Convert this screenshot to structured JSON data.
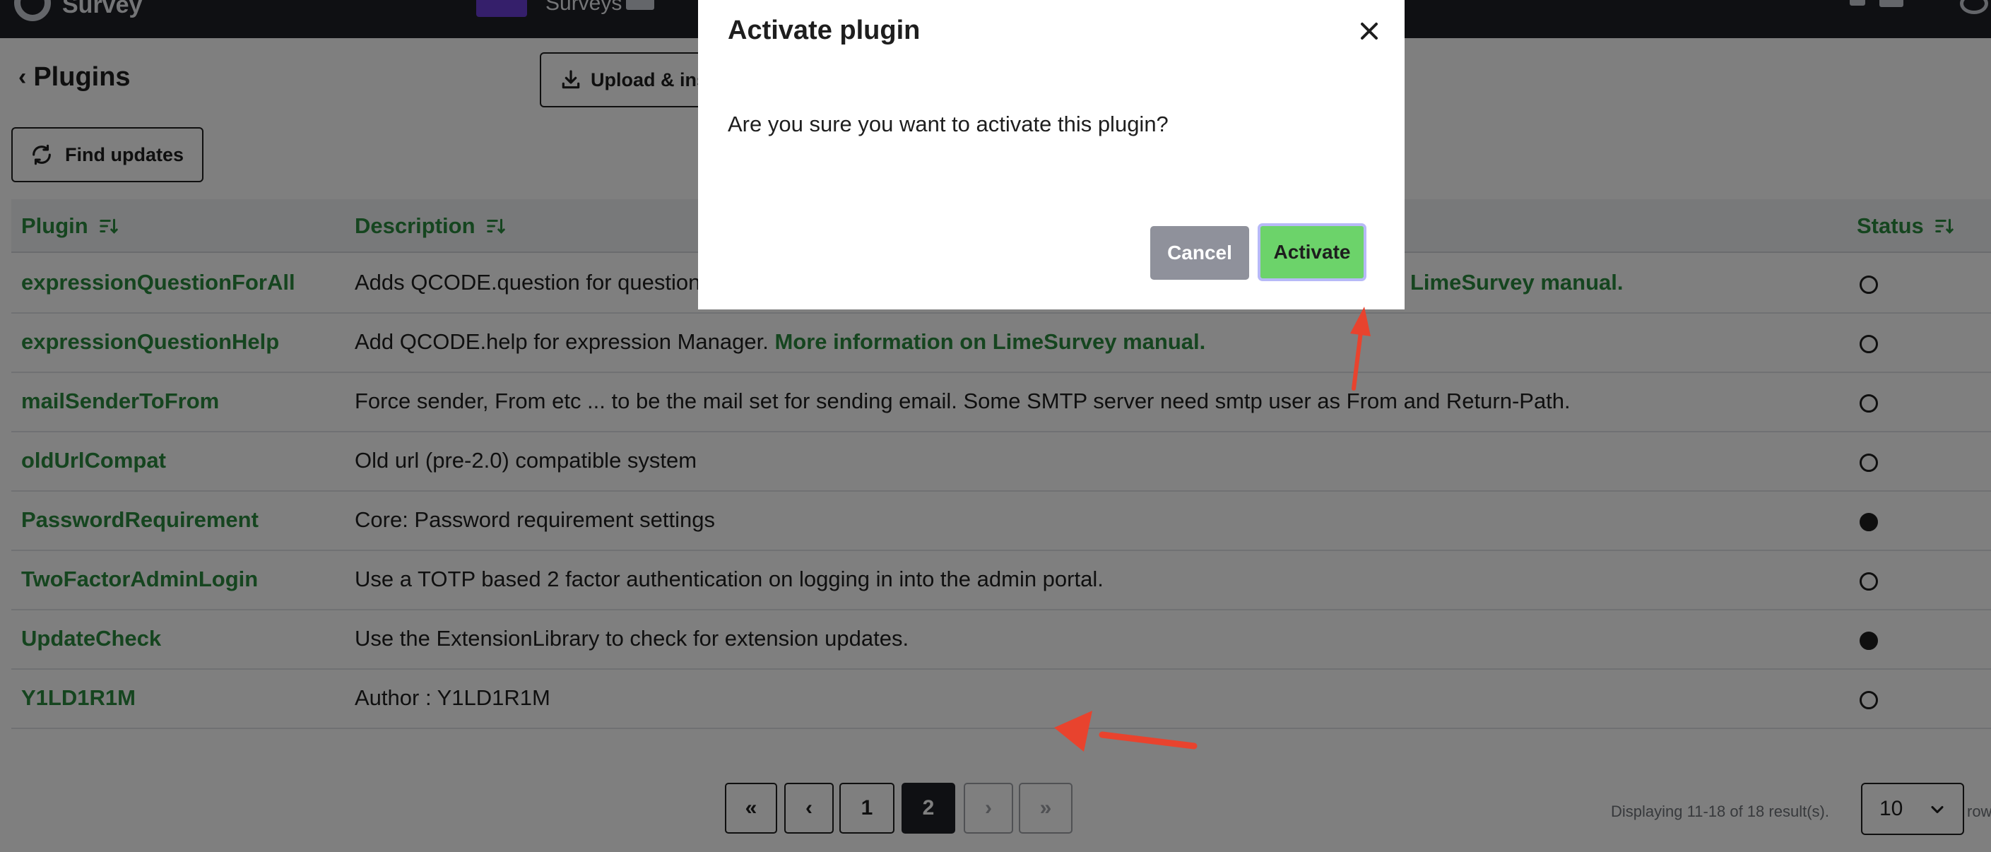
{
  "navbar": {
    "brand": "Survey",
    "surveys_label": "Surveys"
  },
  "header": {
    "back_label": "Plugins",
    "upload_label": "Upload & install",
    "find_updates_label": "Find updates"
  },
  "table": {
    "columns": {
      "plugin": "Plugin",
      "description": "Description",
      "status": "Status"
    },
    "rows": [
      {
        "name": "expressionQuestionForAll",
        "desc": "Adds QCODE.question for question",
        "link": "LimeSurvey manual.",
        "active": false
      },
      {
        "name": "expressionQuestionHelp",
        "desc": "Add QCODE.help for expression Manager.",
        "link": "More information on LimeSurvey manual.",
        "active": false
      },
      {
        "name": "mailSenderToFrom",
        "desc": "Force sender, From etc ... to be the mail set for sending email. Some SMTP server need smtp user as From and Return-Path.",
        "link": "",
        "active": false
      },
      {
        "name": "oldUrlCompat",
        "desc": "Old url (pre-2.0) compatible system",
        "link": "",
        "active": false
      },
      {
        "name": "PasswordRequirement",
        "desc": "Core: Password requirement settings",
        "link": "",
        "active": true
      },
      {
        "name": "TwoFactorAdminLogin",
        "desc": "Use a TOTP based 2 factor authentication on logging in into the admin portal.",
        "link": "",
        "active": false
      },
      {
        "name": "UpdateCheck",
        "desc": "Use the ExtensionLibrary to check for extension updates.",
        "link": "",
        "active": true
      },
      {
        "name": "Y1LD1R1M",
        "desc": "Author : Y1LD1R1M",
        "link": "",
        "active": false
      }
    ]
  },
  "pagination": {
    "first": "«",
    "prev": "‹",
    "page1": "1",
    "page2": "2",
    "next": "›",
    "last": "»",
    "summary": "Displaying 11-18 of 18 result(s).",
    "page_size": "10",
    "rows_label": "rows"
  },
  "modal": {
    "title": "Activate plugin",
    "body": "Are you sure you want to activate this plugin?",
    "cancel_label": "Cancel",
    "activate_label": "Activate"
  },
  "colors": {
    "accent_green": "#2a8a3e",
    "activate_green": "#6cd36a",
    "navbar": "#1f2127",
    "annotation_red": "#e8432e"
  }
}
